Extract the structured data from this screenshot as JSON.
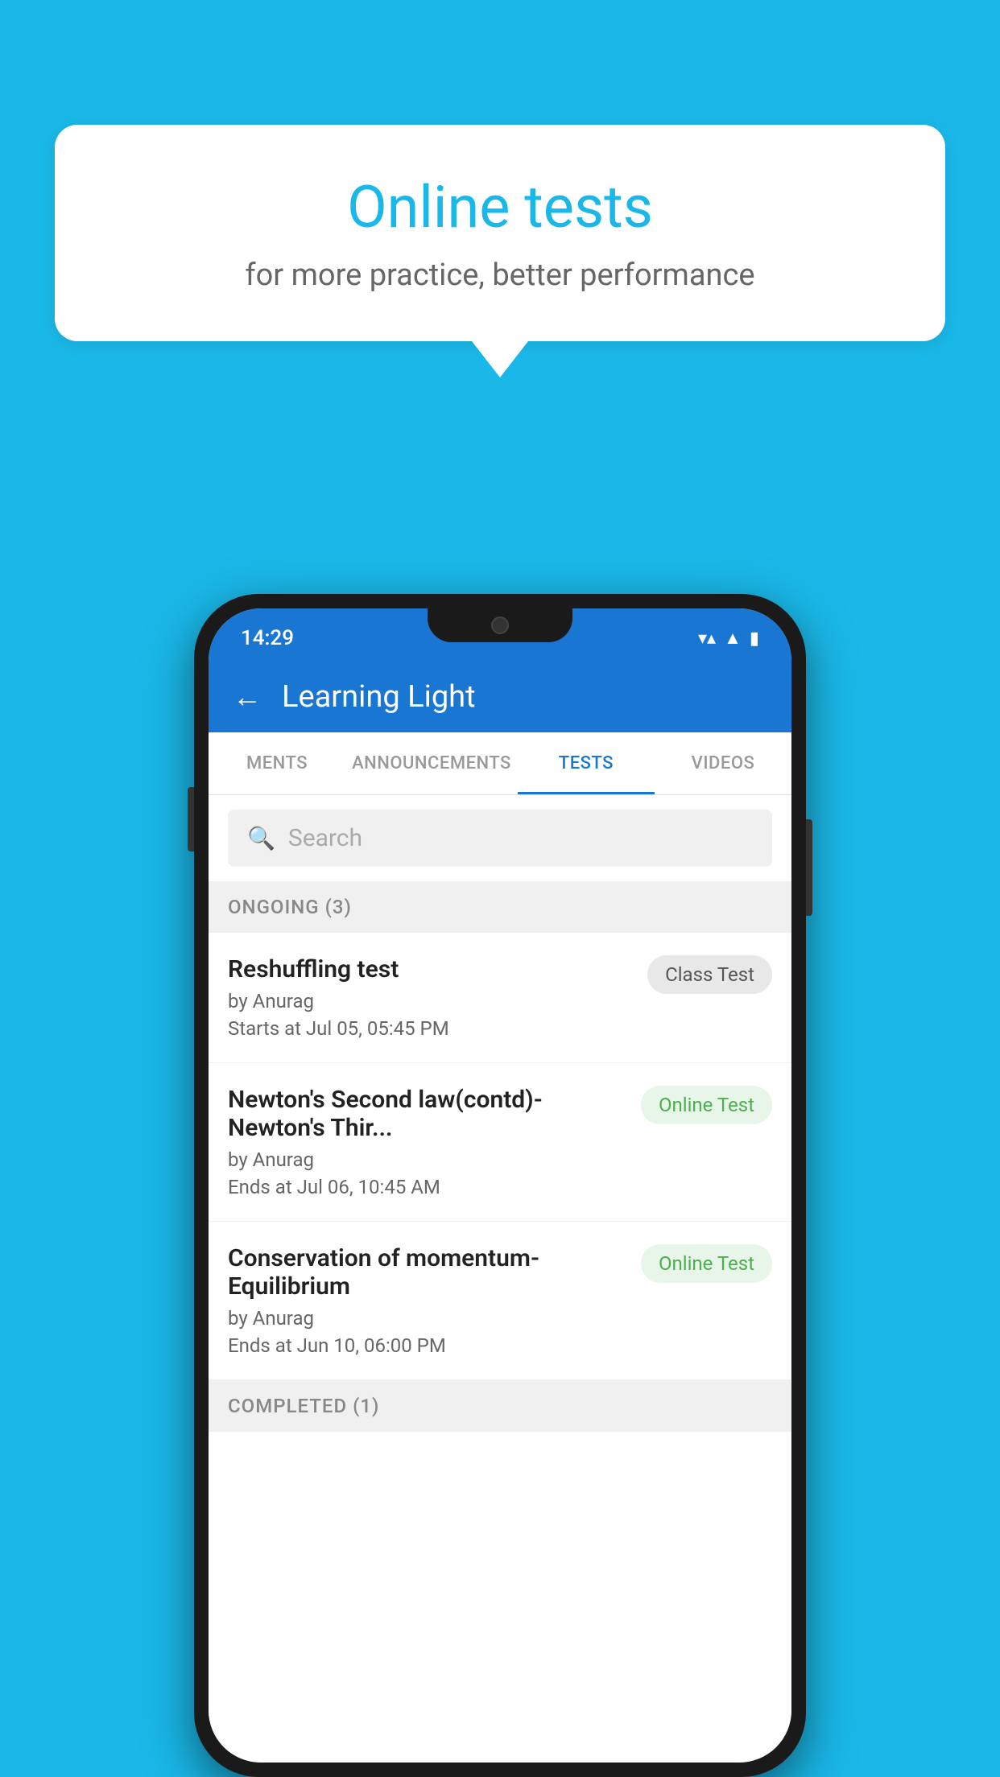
{
  "background": {
    "color": "#1ab8e8"
  },
  "speech_bubble": {
    "title": "Online tests",
    "subtitle": "for more practice, better performance"
  },
  "phone": {
    "status_bar": {
      "time": "14:29",
      "wifi": "▼",
      "signal": "▲",
      "battery": "▮"
    },
    "app_bar": {
      "back_label": "←",
      "title": "Learning Light"
    },
    "tabs": [
      {
        "label": "MENTS",
        "active": false
      },
      {
        "label": "ANNOUNCEMENTS",
        "active": false
      },
      {
        "label": "TESTS",
        "active": true
      },
      {
        "label": "VIDEOS",
        "active": false
      }
    ],
    "search": {
      "placeholder": "Search"
    },
    "ongoing_section": {
      "header": "ONGOING (3)",
      "tests": [
        {
          "name": "Reshuffling test",
          "author": "by Anurag",
          "date": "Starts at  Jul 05, 05:45 PM",
          "badge": "Class Test",
          "badge_type": "class"
        },
        {
          "name": "Newton's Second law(contd)-Newton's Thir...",
          "author": "by Anurag",
          "date": "Ends at  Jul 06, 10:45 AM",
          "badge": "Online Test",
          "badge_type": "online"
        },
        {
          "name": "Conservation of momentum-Equilibrium",
          "author": "by Anurag",
          "date": "Ends at  Jun 10, 06:00 PM",
          "badge": "Online Test",
          "badge_type": "online"
        }
      ]
    },
    "completed_section": {
      "header": "COMPLETED (1)"
    }
  }
}
